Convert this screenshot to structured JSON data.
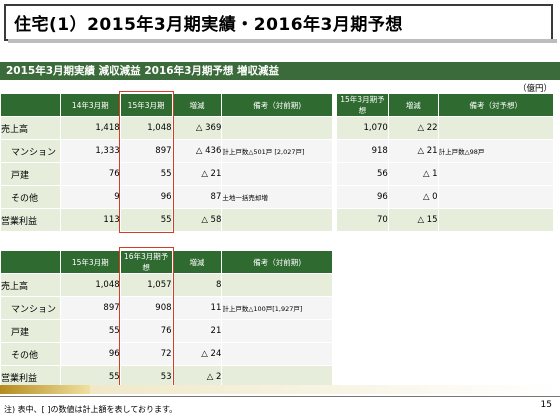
{
  "title": "住宅(1）2015年3月期実績・2016年3月期予想",
  "subtitle": "2015年3月期実績  減収減益    2016年3月期予想  増収減益",
  "unit": "（億円）",
  "table1": {
    "headers": [
      "",
      "14年3月期",
      "15年3月期",
      "増減",
      "備考（対前期)"
    ],
    "rows": [
      {
        "label": "売上高",
        "a": "1,418",
        "b": "1,048",
        "diff": "△ 369",
        "note": ""
      },
      {
        "label": "マンション",
        "a": "1,333",
        "b": "897",
        "diff": "△ 436",
        "note": "計上戸数△501戸 [2,027戸]"
      },
      {
        "label": "戸建",
        "a": "76",
        "b": "55",
        "diff": "△ 21",
        "note": ""
      },
      {
        "label": "その他",
        "a": "9",
        "b": "96",
        "diff": "87",
        "note": "土地一括売却増"
      },
      {
        "label": "営業利益",
        "a": "113",
        "b": "55",
        "diff": "△ 58",
        "note": ""
      }
    ]
  },
  "table2": {
    "headers": [
      "15年3月期予想",
      "増減",
      "備考（対予想）"
    ],
    "rows": [
      {
        "a": "1,070",
        "diff": "△ 22",
        "note": ""
      },
      {
        "a": "918",
        "diff": "△ 21",
        "note": "計上戸数△98戸"
      },
      {
        "a": "56",
        "diff": "△ 1",
        "note": ""
      },
      {
        "a": "96",
        "diff": "△ 0",
        "note": ""
      },
      {
        "a": "70",
        "diff": "△ 15",
        "note": ""
      }
    ]
  },
  "table3": {
    "headers": [
      "",
      "15年3月期",
      "16年3月期予想",
      "増減",
      "備考（対前期)"
    ],
    "rows": [
      {
        "label": "売上高",
        "a": "1,048",
        "b": "1,057",
        "diff": "8",
        "note": ""
      },
      {
        "label": "マンション",
        "a": "897",
        "b": "908",
        "diff": "11",
        "note": "計上戸数△100戸[1,927戸]"
      },
      {
        "label": "戸建",
        "a": "55",
        "b": "76",
        "diff": "21",
        "note": ""
      },
      {
        "label": "その他",
        "a": "96",
        "b": "72",
        "diff": "△ 24",
        "note": ""
      },
      {
        "label": "営業利益",
        "a": "55",
        "b": "53",
        "diff": "△ 2",
        "note": ""
      }
    ]
  },
  "footer_note": "注)  表中、[ ]の数値は計上額を表しております。",
  "page_number": "15"
}
